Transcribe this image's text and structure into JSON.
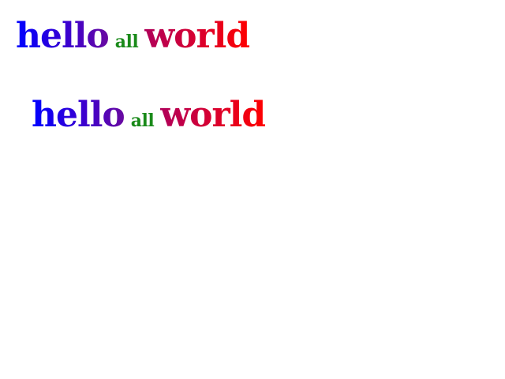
{
  "lines": [
    {
      "word1": "hello",
      "word2": "all",
      "word3": "world"
    },
    {
      "word1": "hello",
      "word2": "all",
      "word3": "world"
    }
  ],
  "colors": {
    "hello_start": "#0000ff",
    "hello_end": "#6a0aa0",
    "all": "#1a8a1a",
    "world_start": "#b0005a",
    "world_end": "#ff0000",
    "background": "#ffffff"
  }
}
